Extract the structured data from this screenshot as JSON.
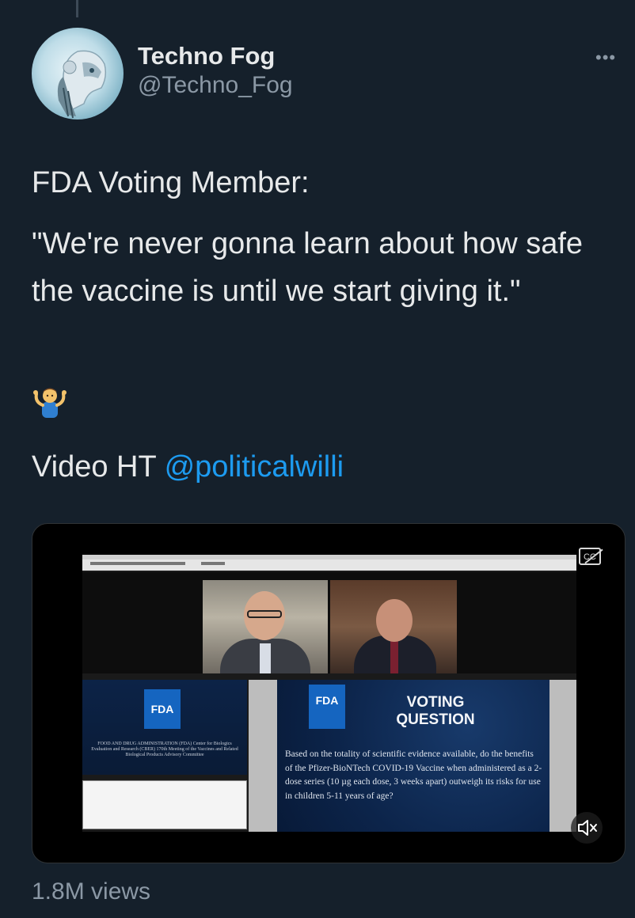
{
  "author": {
    "name": "Techno Fog",
    "handle": "@Techno_Fog"
  },
  "tweet": {
    "line1": "FDA Voting Member:",
    "quote": "\"We're never gonna learn about how safe the vaccine is until we start giving it.\"",
    "emoji": "shrug-person-emoji",
    "credit_prefix": "Video HT ",
    "credit_mention": "@politicalwilli"
  },
  "video": {
    "left_panel": {
      "logo": "FDA",
      "agency_text": "FOOD AND DRUG ADMINISTRATION (FDA) Center for Biologics Evaluation and Research (CBER) 170th Meeting of the Vaccines and Related Biological Products Advisory Committee"
    },
    "slide": {
      "logo": "FDA",
      "title": "VOTING QUESTION",
      "body": "Based on the totality of scientific evidence available, do the benefits of the Pfizer-BioNTech COVID-19 Vaccine when administered as a 2-dose series (10 µg each dose, 3 weeks apart) outweigh its risks for use in children 5-11 years of age?"
    },
    "cc_label": "CC",
    "cc_icon": "closed-captions-off-icon",
    "mute_icon": "speaker-muted-icon"
  },
  "stats": {
    "views": "1.8M views"
  },
  "colors": {
    "background": "#15202b",
    "text": "#e7e9ea",
    "secondary": "#8b98a5",
    "link": "#1d9bf0"
  }
}
